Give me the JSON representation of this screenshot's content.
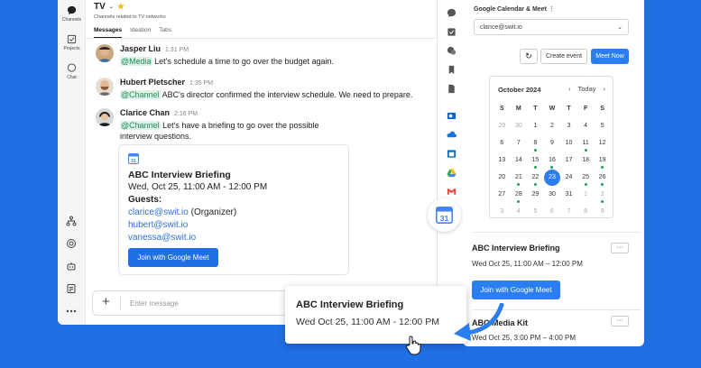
{
  "rail": {
    "items": [
      {
        "label": "Channels",
        "icon": "chat-bubble-icon"
      },
      {
        "label": "Projects",
        "icon": "checkbox-icon"
      },
      {
        "label": "Chat",
        "icon": "speech-icon"
      }
    ],
    "bottom_icons": [
      "org-chart-icon",
      "target-icon",
      "robot-icon",
      "notes-icon",
      "more-icon"
    ]
  },
  "channel": {
    "title": "TV",
    "description": "Channels related to TV networks",
    "tabs": [
      "Messages",
      "Ideation",
      "Tabs"
    ]
  },
  "messages": [
    {
      "name": "Jasper Liu",
      "time": "1:31 PM",
      "mention": "@Media",
      "text": " Let's schedule a time to go over the budget again."
    },
    {
      "name": "Hubert Pletscher",
      "time": "1:35 PM",
      "mention": "@Channel",
      "text": " ABC's director confirmed the interview schedule. We need to prepare."
    },
    {
      "name": "Clarice Chan",
      "time": "2:16 PM",
      "mention": "@Channel",
      "text": " Let's have a briefing to go over the possible",
      "text2": "interview questions."
    }
  ],
  "card": {
    "title": "ABC Interview Briefing",
    "datetime": "Wed, Oct 25, 11:00 AM - 12:00 PM",
    "guests_label": "Guests:",
    "guest1": "clarice@swit.io",
    "guest1_suffix": " (Organizer)",
    "guest2": "hubert@swit.io",
    "guest3": "vanessa@swit.io",
    "button": "Join with Google Meet"
  },
  "composer": {
    "placeholder": "Enter message"
  },
  "panel": {
    "title": "Google Calendar & Meet",
    "account": "clarice@swit.io",
    "create_event": "Create event",
    "meet_now": "Meet Now",
    "month": "October 2024",
    "today": "Today",
    "weekdays": [
      "S",
      "M",
      "T",
      "W",
      "T",
      "F",
      "S"
    ],
    "weeks": [
      [
        "29",
        "30",
        "1",
        "2",
        "3",
        "4",
        "5"
      ],
      [
        "6",
        "7",
        "8",
        "9",
        "10",
        "11",
        "12"
      ],
      [
        "13",
        "14",
        "15",
        "16",
        "17",
        "18",
        "19"
      ],
      [
        "20",
        "21",
        "22",
        "23",
        "24",
        "25",
        "26"
      ],
      [
        "27",
        "28",
        "29",
        "30",
        "31",
        "1",
        "2"
      ],
      [
        "3",
        "4",
        "5",
        "6",
        "7",
        "8",
        "9"
      ]
    ],
    "events": [
      {
        "title": "ABC Interview Briefing",
        "time": "Wed Oct 25, 11:00 AM – 12:00 PM",
        "button": "Join with Google Meet"
      },
      {
        "title": "ABC Media Kit",
        "time": "Wed Oct 25, 3:00 PM – 4:00 PM"
      }
    ]
  },
  "popup": {
    "title": "ABC Interview Briefing",
    "time": "Wed Oct 25, 11:00 AM - 12:00 PM"
  },
  "colors": {
    "accent": "#1f6fe5",
    "mention_bg": "#dff2e7",
    "mention_text": "#1f8f5a",
    "event_dot": "#1aa260"
  }
}
